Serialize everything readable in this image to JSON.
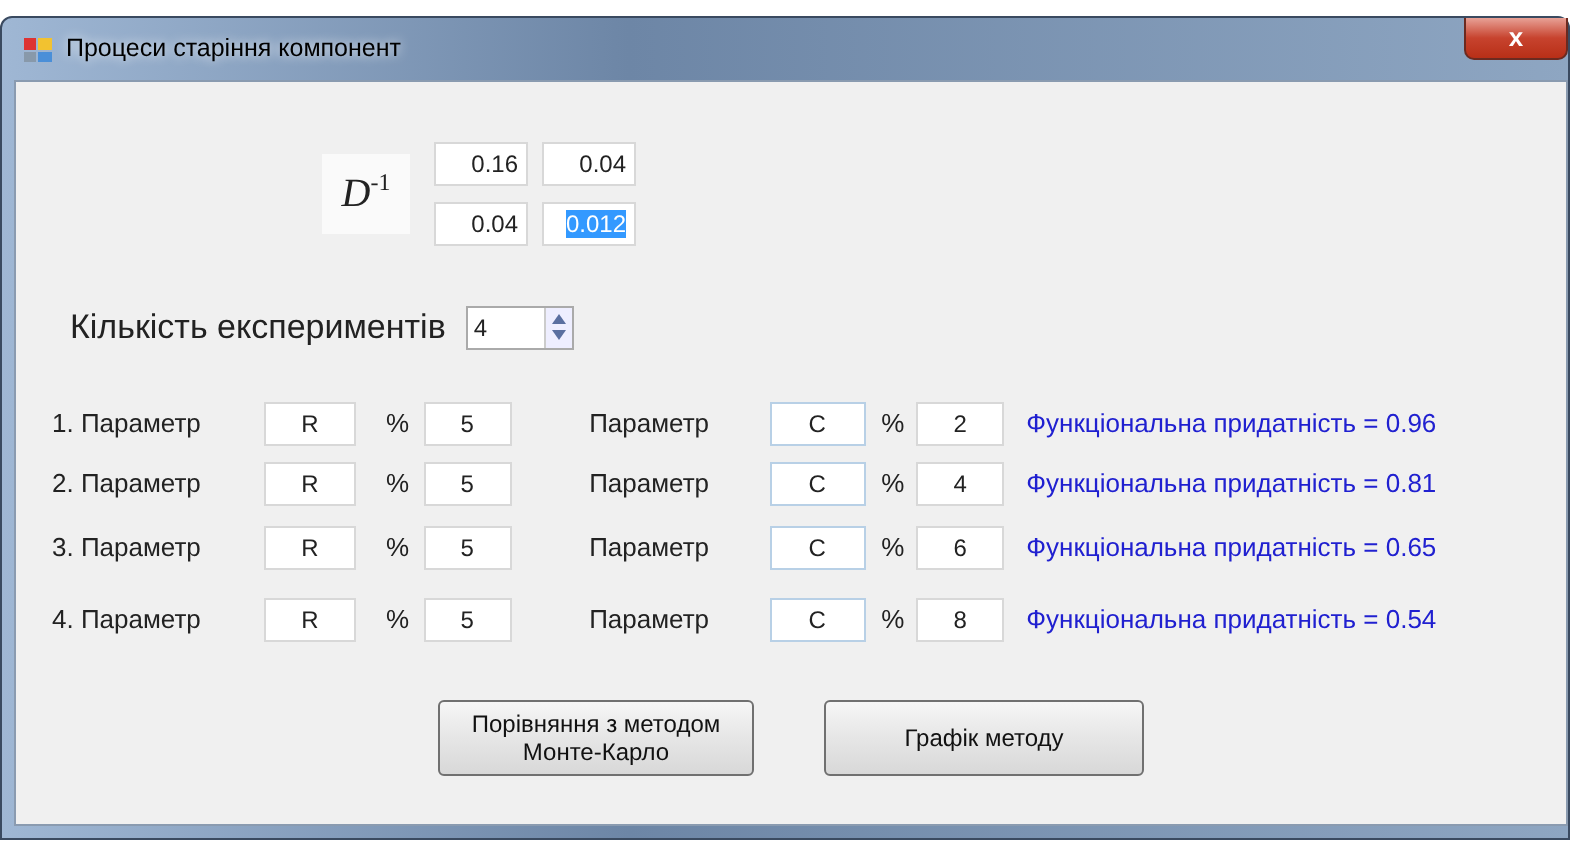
{
  "window": {
    "title": "Процеси старіння компонент",
    "close": "x"
  },
  "matrix": {
    "label": "D$^{-1}$",
    "cells": [
      {
        "value": "0.16",
        "selected": false
      },
      {
        "value": "0.04",
        "selected": false
      },
      {
        "value": "0.04",
        "selected": false
      },
      {
        "value": "0.012",
        "selected": true
      }
    ]
  },
  "experiments": {
    "label": "Кількість експериментів",
    "value": "4"
  },
  "rows": [
    {
      "label": "1. Параметр",
      "param1": "R",
      "pct1": "%",
      "value1": "5",
      "label2": "Параметр",
      "param2": "C",
      "pct2": "%",
      "value2": "2",
      "result": "Функціональна придатність = 0.96"
    },
    {
      "label": "2. Параметр",
      "param1": "R",
      "pct1": "%",
      "value1": "5",
      "label2": "Параметр",
      "param2": "C",
      "pct2": "%",
      "value2": "4",
      "result": "Функціональна придатність = 0.81"
    },
    {
      "label": "3. Параметр",
      "param1": "R",
      "pct1": "%",
      "value1": "5",
      "label2": "Параметр",
      "param2": "C",
      "pct2": "%",
      "value2": "6",
      "result": "Функціональна придатність = 0.65"
    },
    {
      "label": "4. Параметр",
      "param1": "R",
      "pct1": "%",
      "value1": "5",
      "label2": "Параметр",
      "param2": "C",
      "pct2": "%",
      "value2": "8",
      "result": "Функціональна придатність = 0.54"
    }
  ],
  "buttons": [
    "Порівняння з методом\nМонте-Карло",
    "Графік методу"
  ]
}
